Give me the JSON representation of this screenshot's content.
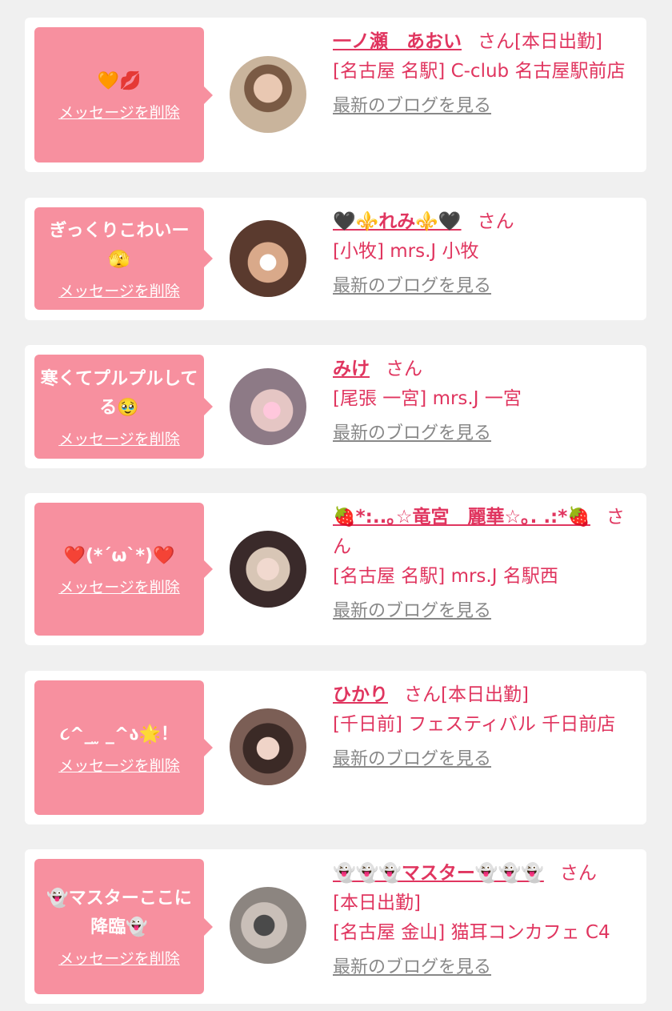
{
  "delete_label": "メッセージを削除",
  "blog_label": "最新のブログを見る",
  "honorific": "さん",
  "cards": [
    {
      "message": "🧡💋",
      "name": "一ノ瀬　あおい",
      "status": "[本日出勤]",
      "shop": "[名古屋 名駅] C-club 名古屋駅前店"
    },
    {
      "message": "ぎっくりこわいー🫣",
      "name": "🖤⚜️れみ⚜️🖤",
      "status": "",
      "shop": "[小牧] mrs.J 小牧"
    },
    {
      "message": "寒くてプルプルしてる🥹",
      "name": "みけ",
      "status": "",
      "shop": "[尾張 一宮] mrs.J 一宮"
    },
    {
      "message": "❤️(*´ω`*)❤️",
      "name": "🍓*:..｡☆竜宮　麗華☆｡. .:*🍓",
      "status": "",
      "shop": "[名古屋 名駅] mrs.J 名駅西"
    },
    {
      "message": "૮^_ ̫ _^ა🌟！",
      "name": "ひかり",
      "status": "[本日出勤]",
      "shop": "[千日前] フェスティバル 千日前店"
    },
    {
      "message": "👻マスターここに降臨👻",
      "name": "👻👻👻マスター👻👻👻",
      "status": "[本日出勤]",
      "shop": "[名古屋 金山] 猫耳コンカフェ C4"
    }
  ]
}
